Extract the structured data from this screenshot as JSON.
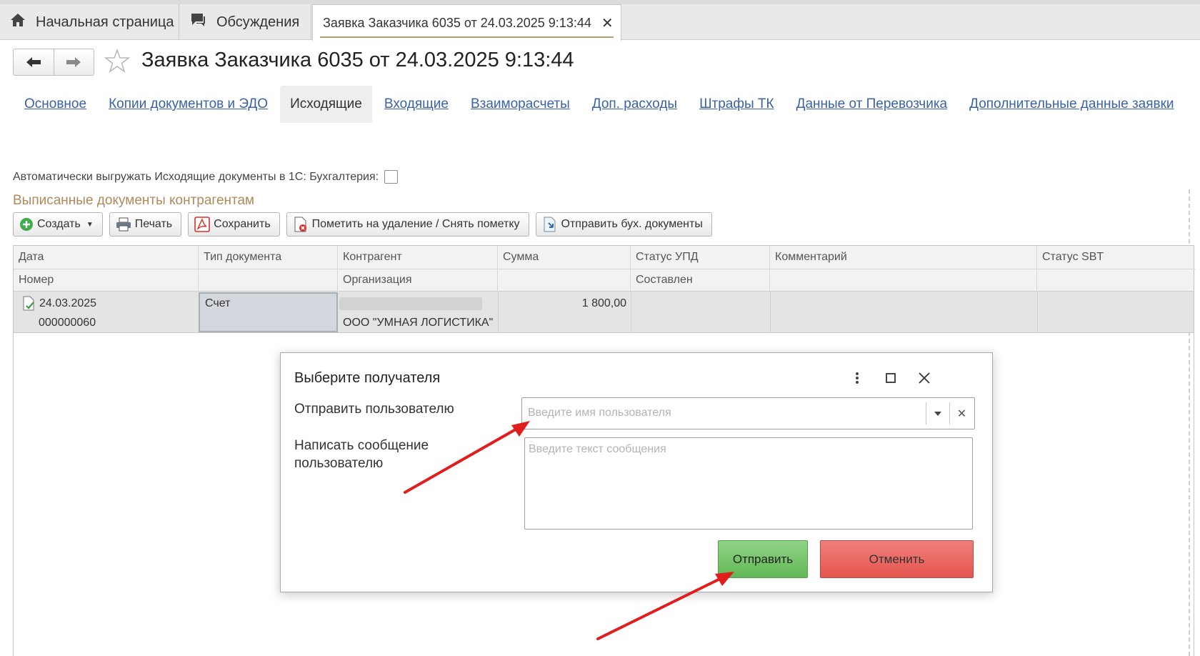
{
  "tabs": [
    {
      "label": "Начальная страница",
      "icon": "home-icon"
    },
    {
      "label": "Обсуждения",
      "icon": "chat-icon"
    },
    {
      "label": "Заявка Заказчика 6035 от 24.03.2025 9:13:44",
      "icon": "close-icon"
    }
  ],
  "page": {
    "title": "Заявка Заказчика 6035 от 24.03.2025 9:13:44"
  },
  "subtabs": [
    "Основное",
    "Копии документов и ЭДО",
    "Исходящие",
    "Входящие",
    "Взаиморасчеты",
    "Доп. расходы",
    "Штрафы ТК",
    "Данные от Перевозчика",
    "Дополнительные данные заявки"
  ],
  "active_subtab": "Исходящие",
  "auto_export": {
    "label": "Автоматически выгружать Исходящие документы в 1С: Бухгалтерия:",
    "checked": false
  },
  "section_title": "Выписанные документы контрагентам",
  "toolbar": {
    "create": "Создать",
    "print": "Печать",
    "save": "Сохранить",
    "mark_delete": "Пометить на удаление / Снять пометку",
    "send_docs": "Отправить бух. документы"
  },
  "table": {
    "headers_top": [
      "Дата",
      "Тип документа",
      "Контрагент",
      "Сумма",
      "Статус УПД",
      "Комментарий",
      "Статус SBT"
    ],
    "headers_bottom": [
      "Номер",
      "",
      "Организация",
      "",
      "Составлен",
      "",
      ""
    ],
    "rows": [
      {
        "date": "24.03.2025",
        "number": "000000060",
        "doc_type": "Счет",
        "counterparty": "",
        "organization": "ООО \"УМНАЯ ЛОГИСТИКА\"",
        "sum": "1 800,00",
        "upd_status": "",
        "composed": "",
        "comment": "",
        "sbt_status": ""
      }
    ]
  },
  "modal": {
    "title": "Выберите получателя",
    "user_label": "Отправить пользователю",
    "user_placeholder": "Введите имя пользователя",
    "message_label_1": "Написать сообщение",
    "message_label_2": "пользователю",
    "message_placeholder": "Введите текст сообщения",
    "send": "Отправить",
    "cancel": "Отменить"
  },
  "colors": {
    "accent_link": "#3a62a7",
    "section_title": "#b0895a",
    "send_button": "#6abb5d",
    "cancel_button": "#e8605a",
    "annotation_arrow": "#e01e1e"
  }
}
